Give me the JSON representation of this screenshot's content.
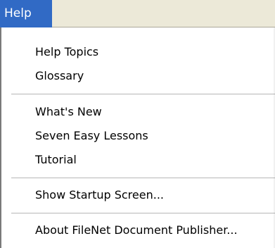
{
  "menu": {
    "title": "Help",
    "items": [
      {
        "label": "Help Topics"
      },
      {
        "label": "Glossary"
      },
      {
        "label": "What's New"
      },
      {
        "label": "Seven Easy Lessons"
      },
      {
        "label": "Tutorial"
      },
      {
        "label": "Show Startup Screen..."
      },
      {
        "label": "About FileNet Document Publisher..."
      }
    ]
  }
}
